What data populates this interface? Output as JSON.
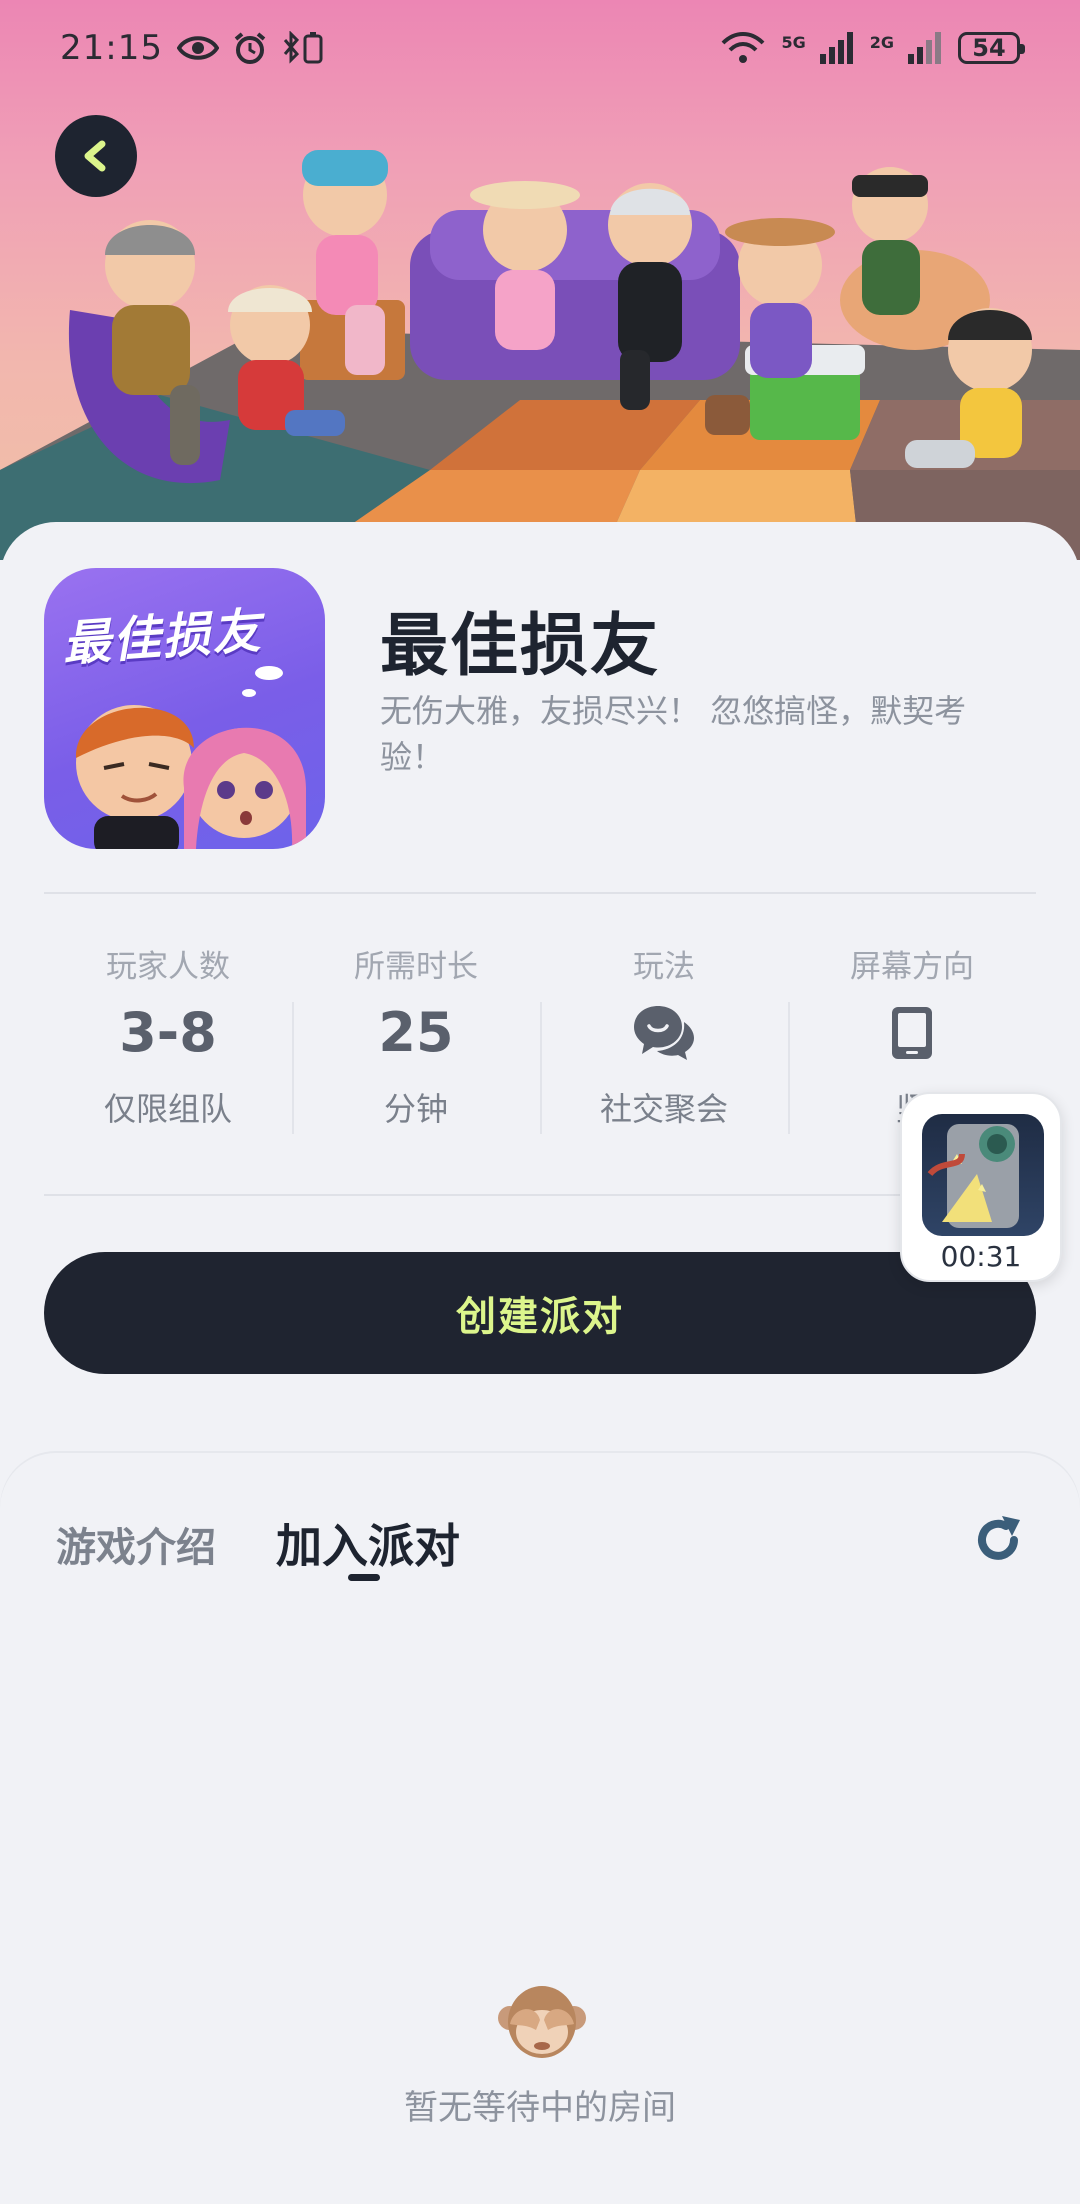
{
  "status_bar": {
    "time": "21:15",
    "network_1": "5G",
    "network_2": "2G",
    "battery": "54"
  },
  "game": {
    "title": "最佳损友",
    "icon_title": "最佳损友",
    "description": "无伤大雅，友损尽兴！ 忽悠搞怪，默契考验！"
  },
  "stats": [
    {
      "label": "玩家人数",
      "value": "3-8",
      "sub": "仅限组队"
    },
    {
      "label": "所需时长",
      "value": "25",
      "sub": "分钟"
    },
    {
      "label": "玩法",
      "icon": "chat-bubbles-icon",
      "sub": "社交聚会"
    },
    {
      "label": "屏幕方向",
      "icon": "phone-portrait-icon",
      "sub": "竖"
    }
  ],
  "actions": {
    "create_party": "创建派对"
  },
  "floating_window": {
    "time": "00:31"
  },
  "tabs": [
    {
      "label": "游戏介绍",
      "active": false
    },
    {
      "label": "加入派对",
      "active": true
    }
  ],
  "empty_state": {
    "text": "暂无等待中的房间",
    "icon": "monkey-covering-eyes-icon"
  },
  "colors": {
    "accent_text": "#dcf58c",
    "button_dark": "#1f2430",
    "hero_top": "#ec86b4",
    "hero_bottom": "#f0c0a6",
    "refresh": "#3b5e7a"
  }
}
